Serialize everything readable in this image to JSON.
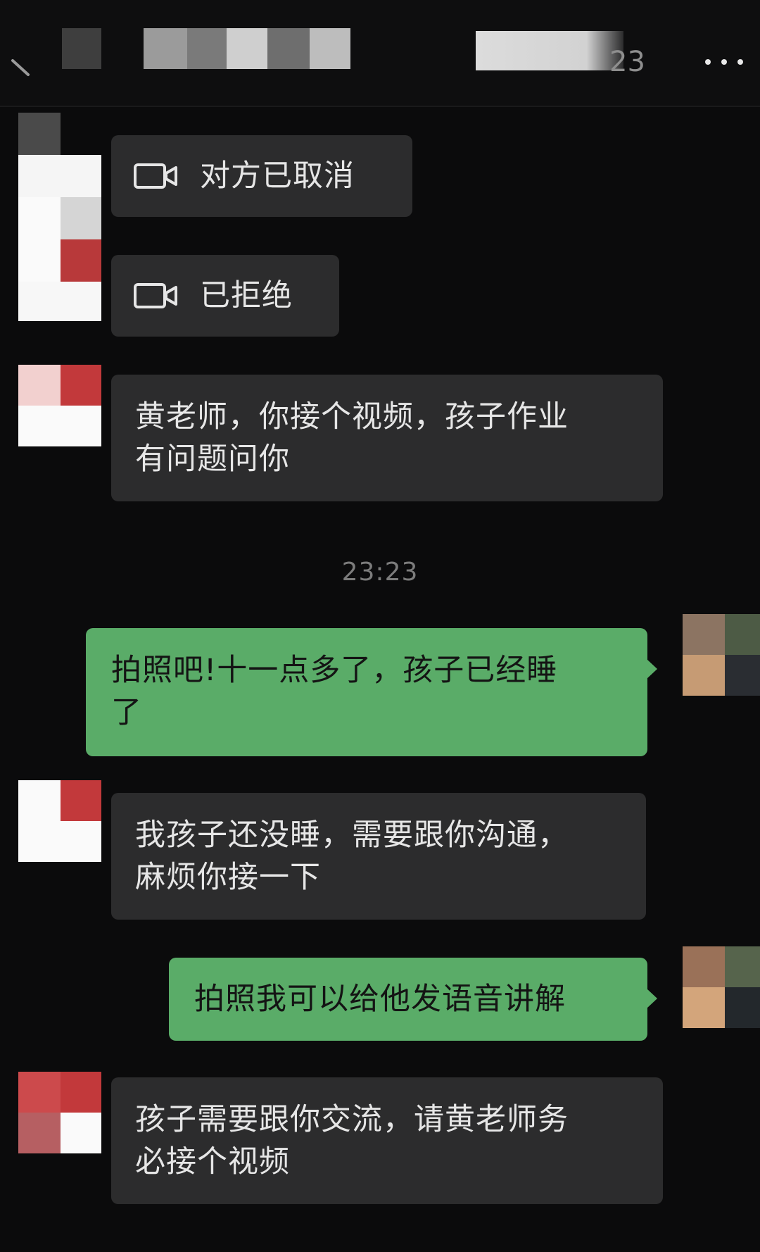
{
  "header": {
    "partial_time": "23",
    "back_icon": "chevron-left-icon",
    "more_icon": "more-dots-icon"
  },
  "messages": [
    {
      "id": "m1",
      "direction": "incoming",
      "type": "video-call",
      "icon": "video-camera-icon",
      "text": "对方已取消"
    },
    {
      "id": "m2",
      "direction": "incoming",
      "type": "video-call",
      "icon": "video-camera-icon",
      "text": "已拒绝"
    },
    {
      "id": "m3",
      "direction": "incoming",
      "type": "text",
      "lines": [
        "黄老师，你接个视频，孩子作业",
        "有问题问你"
      ]
    },
    {
      "id": "m4",
      "direction": "outgoing",
      "type": "text",
      "lines": [
        "拍照吧!十一点多了，孩子已经睡",
        "了"
      ]
    },
    {
      "id": "m5",
      "direction": "incoming",
      "type": "text",
      "lines": [
        "我孩子还没睡，需要跟你沟通，",
        "麻烦你接一下"
      ]
    },
    {
      "id": "m6",
      "direction": "outgoing",
      "type": "text",
      "lines": [
        "拍照我可以给他发语音讲解"
      ]
    },
    {
      "id": "m7",
      "direction": "incoming",
      "type": "text",
      "lines": [
        "孩子需要跟你交流，请黄老师务",
        "必接个视频"
      ]
    }
  ],
  "timestamp": "23:23",
  "colors": {
    "background": "#0b0b0c",
    "incoming_bubble": "#2c2c2d",
    "outgoing_bubble": "#5aac68",
    "incoming_text": "#e6e6e6",
    "outgoing_text": "#141414",
    "timestamp_text": "#7c7c7c"
  }
}
